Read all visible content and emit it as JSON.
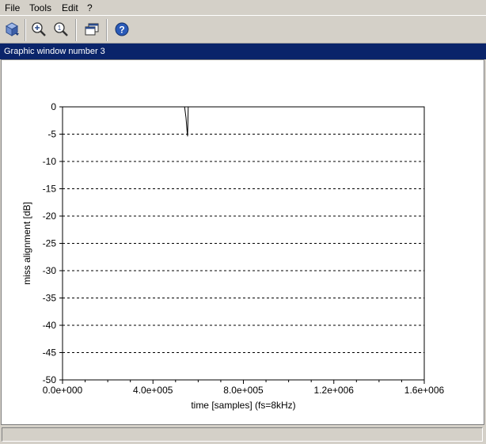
{
  "menu": {
    "file": "File",
    "tools": "Tools",
    "edit": "Edit",
    "help": "?"
  },
  "toolbar": {
    "icons": [
      "rotate-icon",
      "zoom-in-icon",
      "zoom-reset-icon",
      "windows-icon",
      "help-icon"
    ]
  },
  "window": {
    "title": "Graphic window number 3"
  },
  "colors": {
    "title_bar": "#0a246a",
    "chrome": "#d4d0c8",
    "plot_line": "#000000"
  },
  "chart_data": {
    "type": "line",
    "title": "",
    "xlabel": "time [samples] (fs=8kHz)",
    "ylabel": "miss alignment [dB]",
    "xlim": [
      0,
      1600000
    ],
    "ylim": [
      -50,
      0
    ],
    "xticks": [
      0,
      400000,
      800000,
      1200000,
      1600000
    ],
    "xtick_labels": [
      "0.0e+000",
      "4.0e+005",
      "8.0e+005",
      "1.2e+006",
      "1.6e+006"
    ],
    "yticks": [
      0,
      -5,
      -10,
      -15,
      -20,
      -25,
      -30,
      -35,
      -40,
      -45,
      -50
    ],
    "ytick_labels": [
      "0",
      "-5",
      "-10",
      "-15",
      "-20",
      "-25",
      "-30",
      "-35",
      "-40",
      "-45",
      "-50"
    ],
    "grid": "horizontal dashed",
    "series": [
      {
        "x": [
          540000,
          546000,
          551000,
          553000,
          556000
        ],
        "y": [
          0,
          -2,
          -4.5,
          -5.4,
          0
        ]
      }
    ]
  }
}
